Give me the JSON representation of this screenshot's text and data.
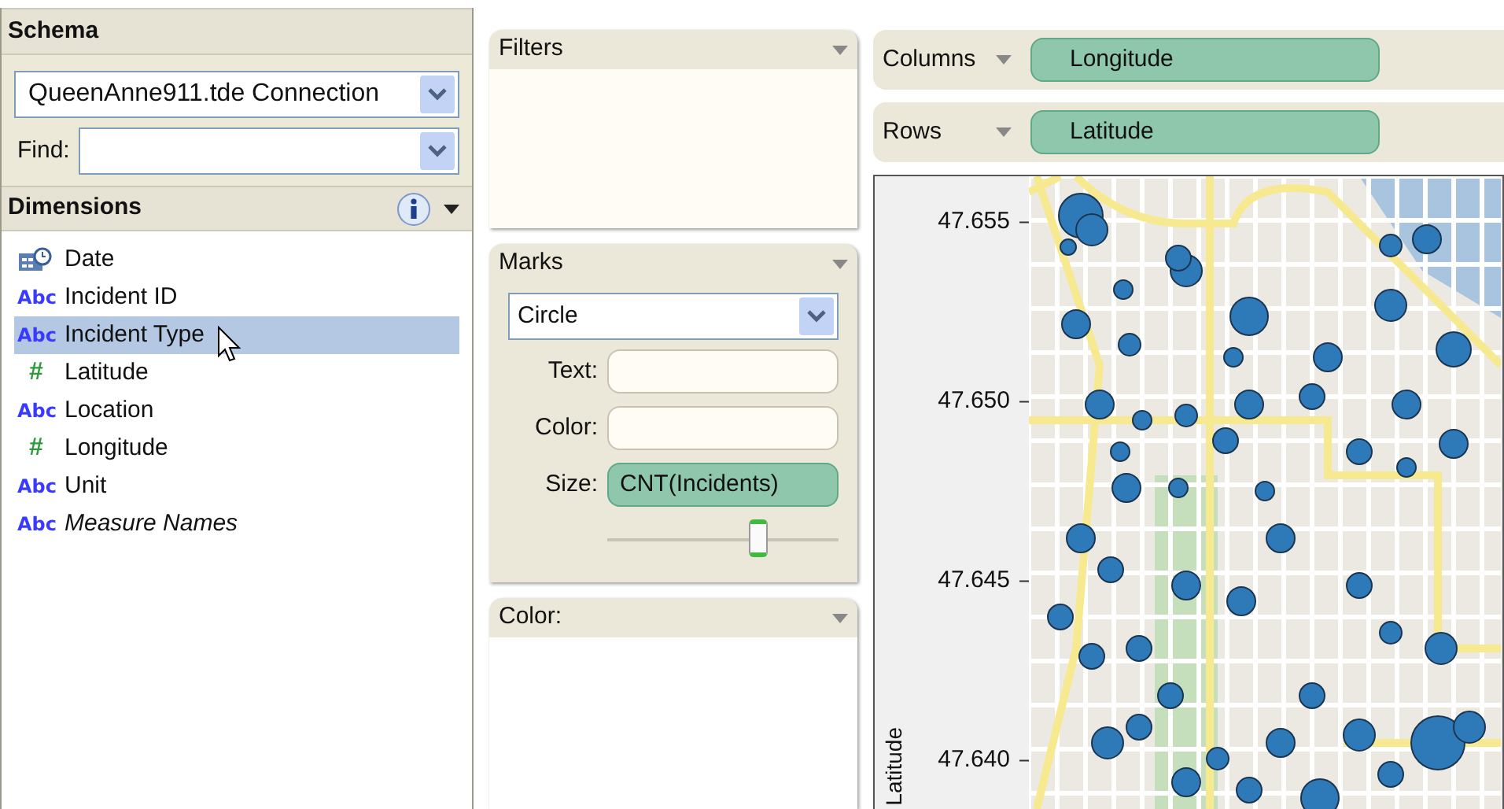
{
  "schema": {
    "title": "Schema",
    "connection": "QueenAnne911.tde Connection",
    "find_label": "Find:"
  },
  "dimensions": {
    "title": "Dimensions",
    "items": [
      {
        "label": "Date",
        "kind": "date",
        "selected": false,
        "italic": false
      },
      {
        "label": "Incident ID",
        "kind": "text",
        "type_icon": "Abc",
        "selected": false,
        "italic": false
      },
      {
        "label": "Incident Type",
        "kind": "text",
        "type_icon": "Abc",
        "selected": true,
        "italic": false
      },
      {
        "label": "Latitude",
        "kind": "number",
        "type_icon": "#",
        "selected": false,
        "italic": false
      },
      {
        "label": "Location",
        "kind": "text",
        "type_icon": "Abc",
        "selected": false,
        "italic": false
      },
      {
        "label": "Longitude",
        "kind": "number",
        "type_icon": "#",
        "selected": false,
        "italic": false
      },
      {
        "label": "Unit",
        "kind": "text",
        "type_icon": "Abc",
        "selected": false,
        "italic": false
      },
      {
        "label": "Measure Names",
        "kind": "text",
        "type_icon": "Abc",
        "selected": false,
        "italic": true
      }
    ]
  },
  "filters": {
    "title": "Filters"
  },
  "marks": {
    "title": "Marks",
    "mark_type": "Circle",
    "fields": [
      {
        "label": "Text:"
      },
      {
        "label": "Color:"
      },
      {
        "label": "Size:",
        "pill": "CNT(Incidents)"
      }
    ],
    "size_slider": {
      "level": 0.65
    }
  },
  "color_legend": {
    "title": "Color:"
  },
  "shelves": [
    {
      "label": "Columns",
      "pill": "Longitude"
    },
    {
      "label": "Rows",
      "pill": "Latitude"
    }
  ],
  "chart": {
    "ylabel": "Latitude",
    "yticks": [
      "47.655",
      "47.650",
      "47.645",
      "47.640"
    ]
  }
}
